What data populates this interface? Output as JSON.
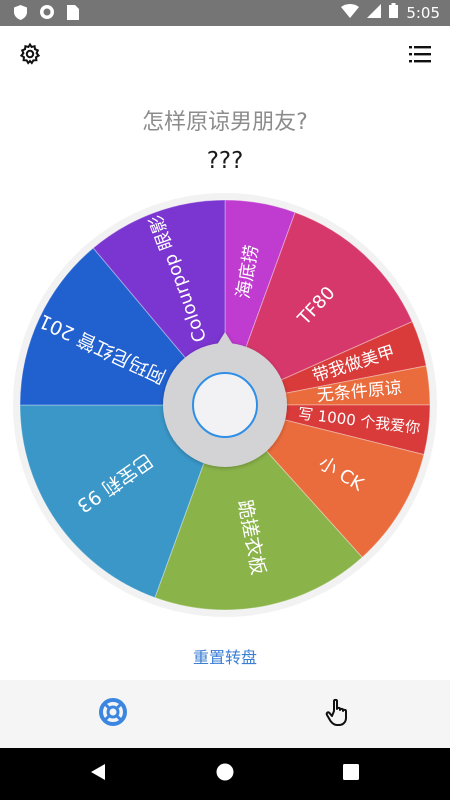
{
  "status": {
    "time": "5:05"
  },
  "header": {
    "settings_icon": "gear-icon",
    "menu_icon": "list-icon"
  },
  "question": "怎样原谅男朋友?",
  "result": "???",
  "wheel": {
    "segments": [
      {
        "label": "海底捞",
        "color": "#c03bcf"
      },
      {
        "label": "TF80",
        "color": "#d6386b"
      },
      {
        "label": "带我做美甲",
        "color": "#d93a3a"
      },
      {
        "label": "无条件原谅",
        "color": "#ea6c3c"
      },
      {
        "label": "写 1000 个我爱你",
        "color": "#d93a3a"
      },
      {
        "label": "小 CK",
        "color": "#ea6c3c"
      },
      {
        "label": "跪搓衣板",
        "color": "#8ab34a"
      },
      {
        "label": "巴宝莉 93",
        "color": "#3a97c8"
      },
      {
        "label": "阿玛尼红管 201",
        "color": "#2160cf"
      },
      {
        "label": "Colourpop 眼影",
        "color": "#7b35d0"
      }
    ]
  },
  "reset_label": "重置转盘",
  "bottom": {
    "wheel_tab_icon": "lifebuoy-icon",
    "tap_tab_icon": "hand-pointer-icon"
  },
  "nav": {
    "back_icon": "back-icon",
    "home_icon": "home-icon",
    "recents_icon": "recents-icon"
  }
}
